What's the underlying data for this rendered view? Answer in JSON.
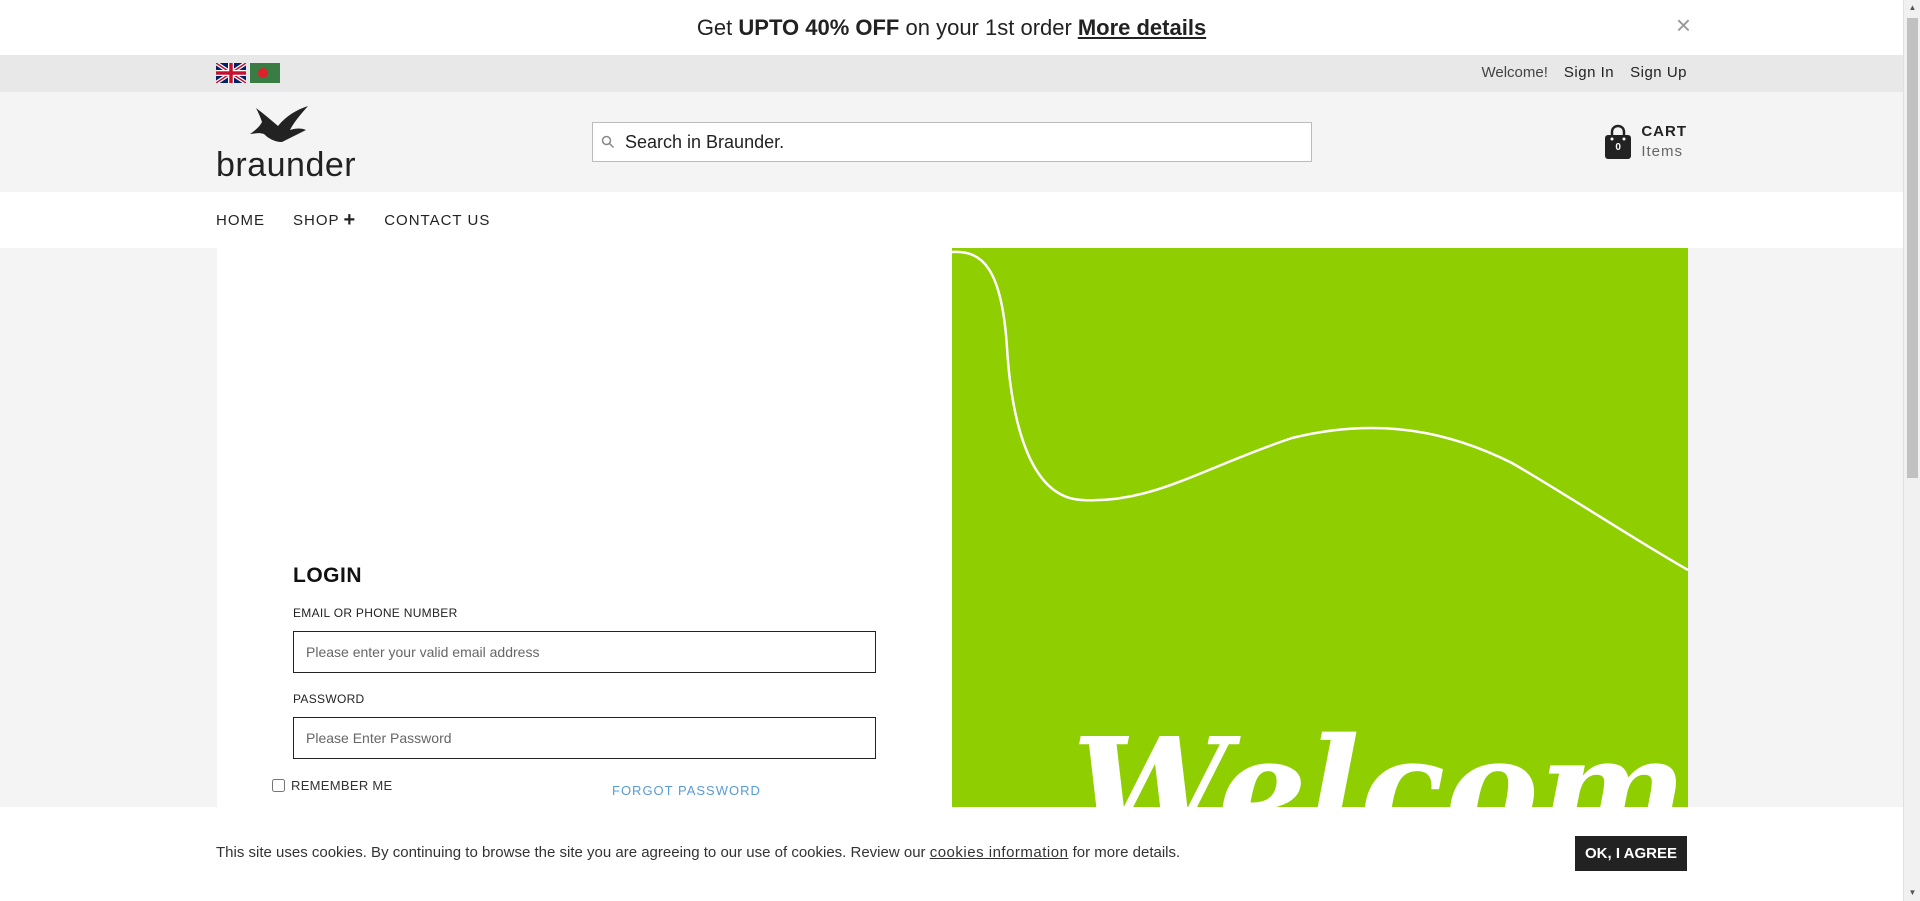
{
  "promo": {
    "prefix": "Get",
    "highlight": "UPTO 40% OFF",
    "suffix": "on your 1st order",
    "link": "More details",
    "close": "×"
  },
  "utility": {
    "welcome": "Welcome!",
    "sign_in": "Sign In",
    "sign_up": "Sign Up",
    "flags": [
      "uk-flag",
      "bangladesh-flag"
    ]
  },
  "header": {
    "logo_text": "braunder",
    "search_placeholder": "Search in Braunder.",
    "cart_label": "CART",
    "cart_items": "Items",
    "cart_count": "0"
  },
  "nav": {
    "items": [
      "HOME",
      "SHOP",
      "CONTACT US"
    ],
    "shop_plus": "+"
  },
  "login": {
    "title": "LOGIN",
    "email_label": "EMAIL OR PHONE NUMBER",
    "email_placeholder": "Please enter your valid email address",
    "password_label": "PASSWORD",
    "password_placeholder": "Please Enter Password",
    "remember": "REMEMBER ME",
    "forgot": "FORGOT PASSWORD"
  },
  "banner": {
    "text": "Welcome",
    "color": "#8fce00"
  },
  "cookie": {
    "text_before": "This site uses cookies. By continuing to browse the site you are agreeing to our use of cookies. Review our",
    "link": "cookies information",
    "text_after": "for more details.",
    "button": "OK, I AGREE"
  },
  "colors": {
    "accent_green": "#8fce00",
    "link_blue": "#5a9bd4",
    "dark": "#222222"
  }
}
